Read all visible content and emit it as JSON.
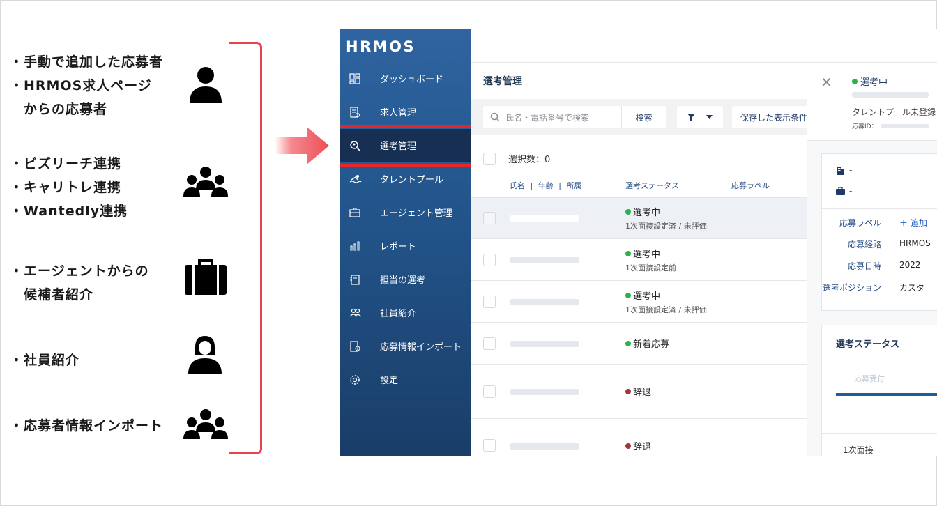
{
  "sources": {
    "group1": [
      "・手動で追加した応募者",
      "・HRMOS求人ページ",
      "　からの応募者"
    ],
    "group2": [
      "・ビズリーチ連携",
      "・キャリトレ連携",
      "・Wantedly連携"
    ],
    "group3": [
      "・エージェントからの",
      "　候補者紹介"
    ],
    "group4": [
      "・社員紹介"
    ],
    "group5": [
      "・応募者情報インポート"
    ]
  },
  "app": {
    "logo": "HRMOS",
    "nav": [
      {
        "label": "ダッシュボード",
        "icon": "dashboard-icon"
      },
      {
        "label": "求人管理",
        "icon": "job-document-icon"
      },
      {
        "label": "選考管理",
        "icon": "search-person-icon"
      },
      {
        "label": "タレントプール",
        "icon": "swimmer-icon"
      },
      {
        "label": "エージェント管理",
        "icon": "briefcase-icon"
      },
      {
        "label": "レポート",
        "icon": "bar-chart-icon"
      },
      {
        "label": "担当の選考",
        "icon": "clipboard-icon"
      },
      {
        "label": "社員紹介",
        "icon": "people-icon"
      },
      {
        "label": "応募情報インポート",
        "icon": "import-icon"
      },
      {
        "label": "設定",
        "icon": "gear-icon"
      }
    ],
    "active_nav": "選考管理",
    "main": {
      "title": "選考管理",
      "search_placeholder": "氏名・電話番号で検索",
      "search_button": "検索",
      "saved_view_button": "保存した表示条件",
      "selected_count": "選択数：0",
      "col_name": "氏名",
      "col_age": "年齢",
      "col_affiliation": "所属",
      "col_sep": "|",
      "col_status": "選考ステータス",
      "col_label": "応募ラベル",
      "rows": [
        {
          "status": "選考中",
          "status_color": "#2bb24c",
          "sub": "1次面接設定済 / 未評価"
        },
        {
          "status": "選考中",
          "status_color": "#2bb24c",
          "sub": "1次面接設定前"
        },
        {
          "status": "選考中",
          "status_color": "#2bb24c",
          "sub": "1次面接設定済 / 未評価"
        },
        {
          "status": "新着応募",
          "status_color": "#2bb24c",
          "sub": ""
        },
        {
          "status": "辞退",
          "status_color": "#a3353a",
          "sub": ""
        },
        {
          "status": "辞退",
          "status_color": "#a3353a",
          "sub": ""
        }
      ]
    },
    "detail": {
      "status": "選考中",
      "talent_pool": "タレントプール未登録",
      "application_id_label": "応募ID：",
      "company": "-",
      "job": "-",
      "kv": [
        {
          "label": "応募ラベル",
          "value": "＋ 追加"
        },
        {
          "label": "応募経路",
          "value": "HRMOS"
        },
        {
          "label": "応募日時",
          "value": "2022"
        },
        {
          "label": "選考ポジション",
          "value": "カスタ"
        }
      ],
      "status_card_title": "選考ステータス",
      "stage": "応募受付",
      "first_interview": "1次面接"
    }
  },
  "colors": {
    "accent_red": "#e8434a",
    "sidebar_blue": "#22548a",
    "green_dot": "#2bb24c",
    "red_dot": "#a3353a"
  }
}
